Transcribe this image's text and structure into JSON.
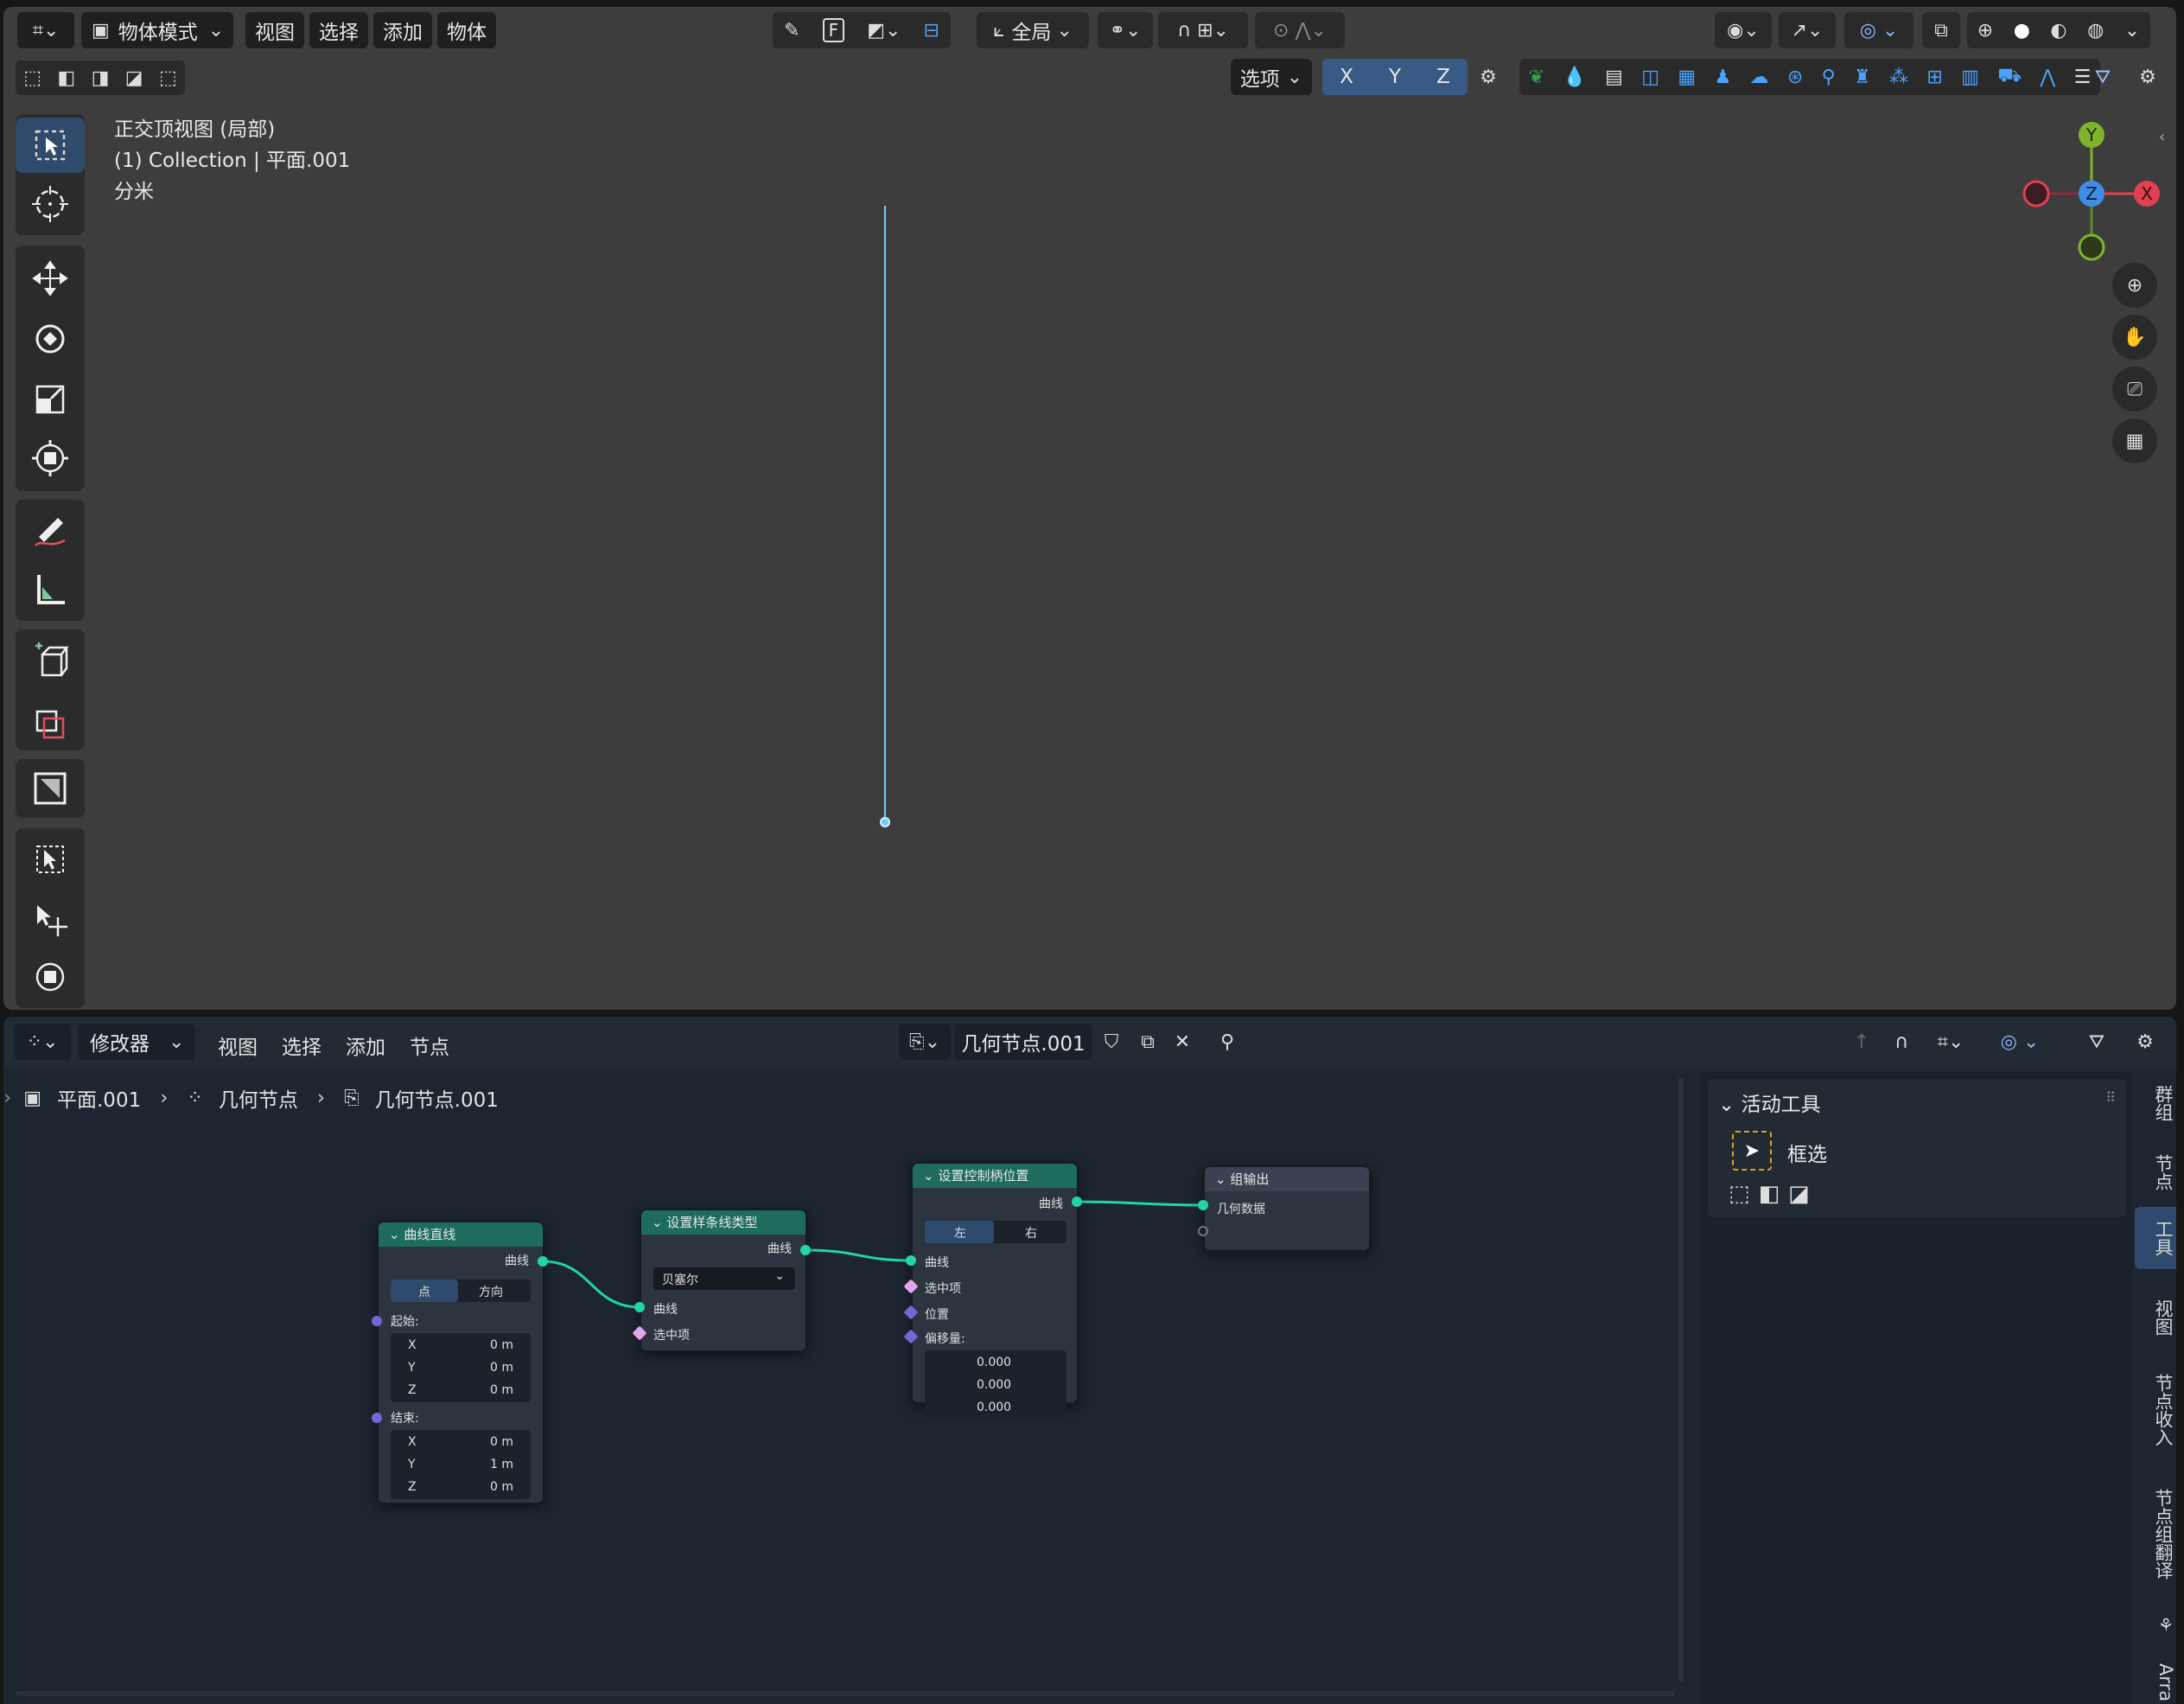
{
  "viewport_header": {
    "mode": "物体模式",
    "menus": [
      "视图",
      "选择",
      "添加",
      "物体"
    ],
    "transform_space": "全局",
    "options": "选项",
    "axes": [
      "X",
      "Y",
      "Z"
    ],
    "f_key": "F"
  },
  "viewport_overlay": {
    "view_name": "正交顶视图 (局部)",
    "collection": "(1) Collection | 平面.001",
    "units": "分米"
  },
  "gizmo": {
    "y": "Y",
    "z": "Z",
    "x": "X"
  },
  "node_header": {
    "editor": "修改器",
    "menus": [
      "视图",
      "选择",
      "添加",
      "节点"
    ],
    "node_tree": "几何节点.001"
  },
  "breadcrumb": [
    "平面.001",
    "几何节点",
    "几何节点.001"
  ],
  "nodes": {
    "curve_line": {
      "title": "曲线直线",
      "out": "曲线",
      "mode_a": "点",
      "mode_b": "方向",
      "start": "起始:",
      "end": "结束:",
      "start_vals": [
        {
          "k": "X",
          "v": "0 m"
        },
        {
          "k": "Y",
          "v": "0 m"
        },
        {
          "k": "Z",
          "v": "0 m"
        }
      ],
      "end_vals": [
        {
          "k": "X",
          "v": "0 m"
        },
        {
          "k": "Y",
          "v": "1 m"
        },
        {
          "k": "Z",
          "v": "0 m"
        }
      ]
    },
    "set_spline": {
      "title": "设置样条线类型",
      "out": "曲线",
      "type": "贝塞尔",
      "in_curve": "曲线",
      "in_sel": "选中项"
    },
    "set_handle": {
      "title": "设置控制柄位置",
      "out": "曲线",
      "left": "左",
      "right": "右",
      "in_curve": "曲线",
      "in_sel": "选中项",
      "in_pos": "位置",
      "in_off": "偏移量:",
      "offsets": [
        "0.000",
        "0.000",
        "0.000"
      ]
    },
    "group_out": {
      "title": "组输出",
      "in_geo": "几何数据"
    }
  },
  "sidepanel": {
    "header": "活动工具",
    "tool": "框选"
  },
  "sidebar_tabs": [
    "群组",
    "节点",
    "工具",
    "视图",
    "节点收入",
    "节点组翻译",
    "Arra"
  ],
  "colors": {
    "accent": "#4a9fe0",
    "node_header": "#1e6c5e",
    "link": "#1fd6a4"
  }
}
